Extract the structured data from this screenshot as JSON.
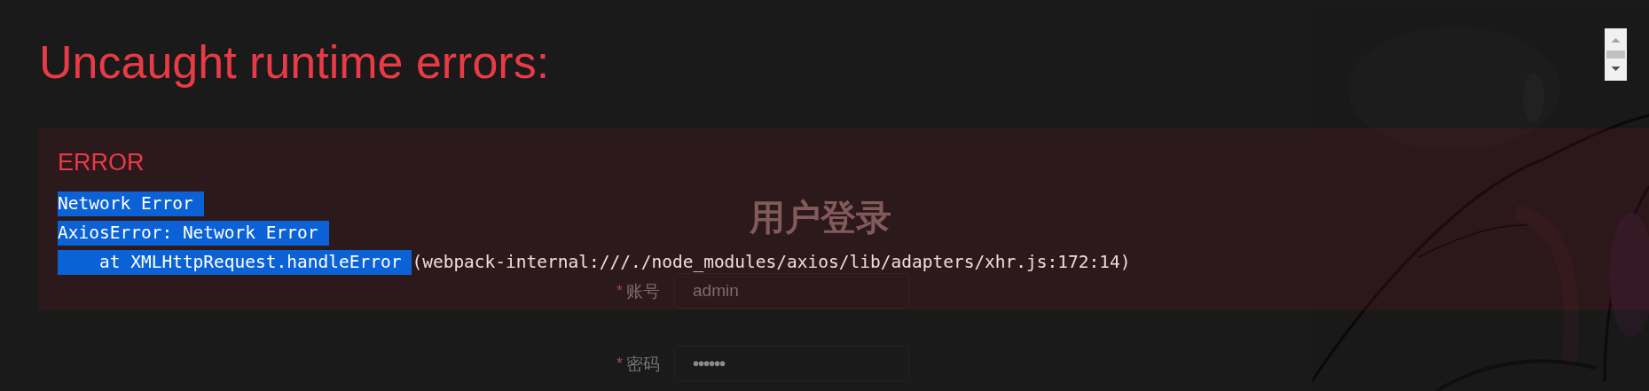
{
  "login": {
    "title": "用户登录",
    "fields": [
      {
        "kind": "text",
        "required_mark": "*",
        "label": "账号",
        "value": "admin"
      },
      {
        "kind": "password",
        "required_mark": "*",
        "label": "密码",
        "value": "••••••"
      }
    ]
  },
  "overlay": {
    "title": "Uncaught runtime errors:",
    "error": {
      "label": "ERROR",
      "lines": [
        {
          "segments": [
            {
              "text": "Network Error",
              "selected": true
            }
          ]
        },
        {
          "segments": [
            {
              "text": "AxiosError: Network Error",
              "selected": true
            }
          ]
        },
        {
          "segments": [
            {
              "text": "    at XMLHttpRequest.handleError",
              "selected": true
            },
            {
              "text": "(webpack-internal:///./node_modules/axios/lib/adapters/xhr.js:172:14)",
              "selected": false
            }
          ]
        }
      ]
    }
  }
}
